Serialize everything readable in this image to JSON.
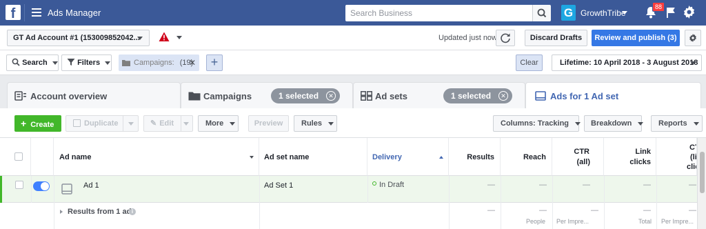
{
  "topbar": {
    "logo": "f",
    "app_title": "Ads Manager",
    "search_placeholder": "Search Business",
    "brand_logo": "G",
    "brand_name": "GrowthTribe",
    "notif_count": "88",
    "icons": [
      "facebook-logo",
      "menu-icon",
      "search-icon",
      "bell-icon",
      "flag-icon",
      "gear-icon"
    ]
  },
  "account_bar": {
    "account_label": "GT Ad Account #1 (153009852042...",
    "updated_text": "Updated just now",
    "discard_label": "Discard Drafts",
    "publish_label": "Review and publish (3)"
  },
  "filter_bar": {
    "search_label": "Search",
    "filters_label": "Filters",
    "chip_label": "Campaigns:",
    "chip_count": "(19)",
    "clear_label": "Clear",
    "lifetime_label": "Lifetime: 10 April 2018 - 3 August 2018"
  },
  "tabs": [
    {
      "label": "Account overview"
    },
    {
      "label": "Campaigns",
      "selected": "1 selected"
    },
    {
      "label": "Ad sets",
      "selected": "1 selected"
    },
    {
      "label": "Ads for 1 Ad set"
    }
  ],
  "toolbar": {
    "create": "Create",
    "duplicate": "Duplicate",
    "edit": "Edit",
    "more": "More",
    "preview": "Preview",
    "rules": "Rules",
    "columns": "Columns: Tracking",
    "breakdown": "Breakdown",
    "reports": "Reports"
  },
  "table": {
    "headers": {
      "ad_name": "Ad name",
      "ad_set_name": "Ad set name",
      "delivery": "Delivery",
      "results": "Results",
      "reach": "Reach",
      "ctr_line1": "CTR",
      "ctr_line2": "(all)",
      "link_line1": "Link",
      "link_line2": "clicks",
      "ctl_line1": "CT",
      "ctl_line2": "(li",
      "ctl_line3": "clic"
    },
    "row": {
      "ad_name": "Ad 1",
      "ad_set_name": "Ad Set 1",
      "delivery": "In Draft",
      "dash": "—"
    },
    "summary": {
      "label": "Results from 1 ad",
      "reach_sub": "People",
      "ctr_sub": "Per Impre...",
      "link_sub": "Total",
      "ctl_sub": "Per Impre..."
    }
  },
  "colors": {
    "topbar": "#3b5998",
    "publish": "#3578e5",
    "create": "#42b72a",
    "accent": "#4267b2"
  }
}
